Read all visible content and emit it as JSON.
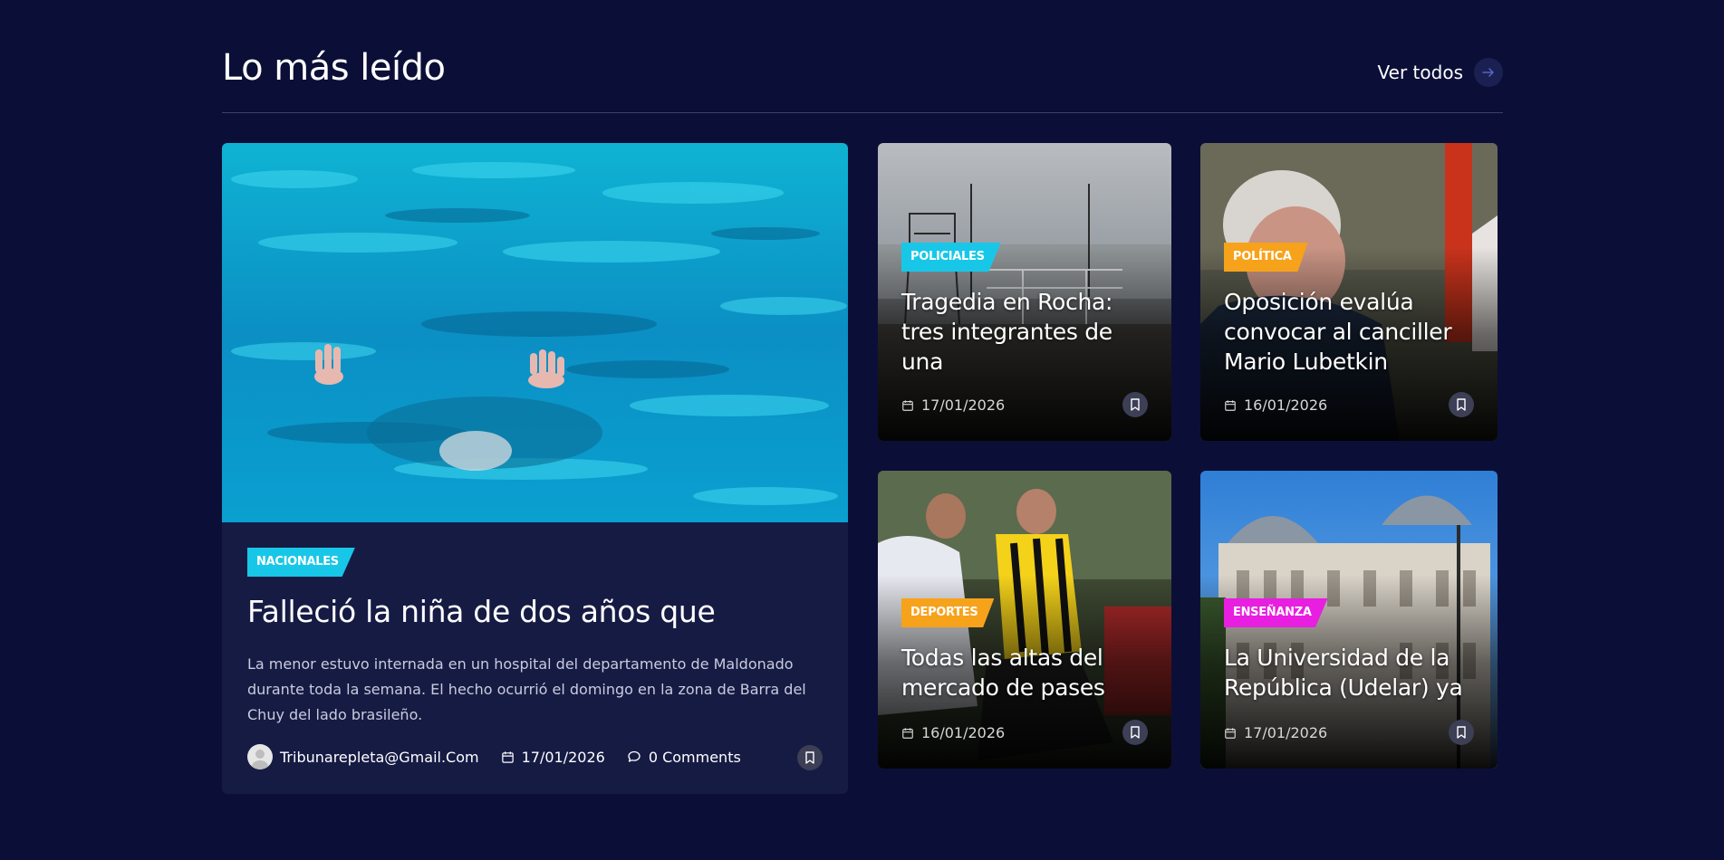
{
  "section": {
    "title": "Lo más leído",
    "view_all_label": "Ver todos"
  },
  "featured": {
    "category": "NACIONALES",
    "category_color": "#18c7e8",
    "title": "Falleció la niña de dos años que",
    "excerpt": "La menor estuvo internada en un hospital del departamento de Maldonado durante toda la semana. El hecho ocurrió el domingo en la zona de Barra del Chuy del lado brasileño.",
    "author": "Tribunarepleta@Gmail.Com",
    "date": "17/01/2026",
    "comments": "0 Comments"
  },
  "cards": [
    {
      "category": "POLICIALES",
      "category_color": "#18c7e8",
      "title": "Tragedia en Rocha: tres integrantes de una",
      "date": "17/01/2026"
    },
    {
      "category": "POLÍTICA",
      "category_color": "#f7a21b",
      "title": "Oposición evalúa convocar al canciller Mario Lubetkin",
      "date": "16/01/2026"
    },
    {
      "category": "DEPORTES",
      "category_color": "#f7a21b",
      "title": "Todas las altas del mercado de pases",
      "date": "16/01/2026"
    },
    {
      "category": "ENSEÑANZA",
      "category_color": "#e81ee0",
      "title": "La Universidad de la República (Udelar) ya",
      "date": "17/01/2026"
    }
  ],
  "icons": {
    "arrow": "arrow-right-icon",
    "calendar": "calendar-icon",
    "comment": "comment-icon",
    "bookmark": "bookmark-icon",
    "avatar": "user-avatar-icon"
  }
}
